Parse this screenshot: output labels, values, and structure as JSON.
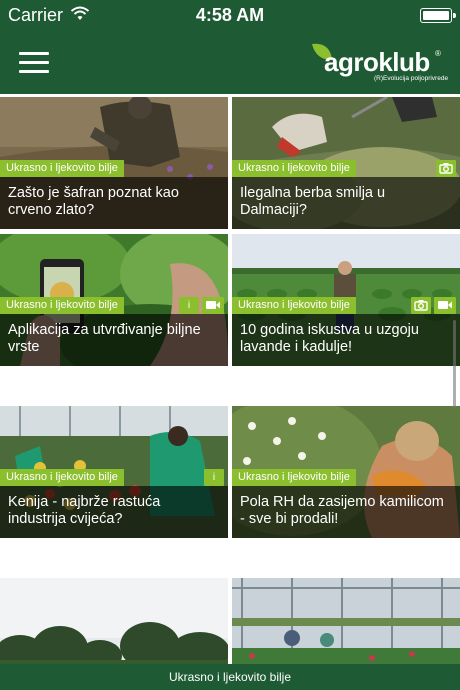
{
  "status_bar": {
    "carrier": "Carrier",
    "time": "4:58 AM"
  },
  "header": {
    "logo_prefix": "agro",
    "logo_suffix": "klub",
    "logo_registered": "®",
    "logo_tagline": "(R)Evolucija poljoprivrede"
  },
  "articles": [
    {
      "category": "Ukrasno i ljekovito bilje",
      "title": "Zašto je šafran poznat kao crveno zlato?",
      "badges": []
    },
    {
      "category": "Ukrasno i ljekovito bilje",
      "title": "Ilegalna berba smilja u Dalmaciji?",
      "badges": [
        "camera-icon"
      ]
    },
    {
      "category": "Ukrasno i ljekovito bilje",
      "title": "Aplikacija za utvrđivanje biljne vrste",
      "badges": [
        "i",
        "video-icon"
      ]
    },
    {
      "category": "Ukrasno i ljekovito bilje",
      "title": "10 godina iskustva u uzgoju lavande i kadulje!",
      "badges": [
        "camera-icon",
        "video-icon"
      ]
    },
    {
      "category": "Ukrasno i ljekovito bilje",
      "title": "Kenija - najbrže rastuća industrija cvijeća?",
      "badges": [
        "i"
      ]
    },
    {
      "category": "Ukrasno i ljekovito bilje",
      "title": "Pola RH da zasijemo kamilicom - sve bi prodali!",
      "badges": []
    },
    {
      "category": "",
      "title": "",
      "badges": []
    },
    {
      "category": "",
      "title": "",
      "badges": []
    }
  ],
  "bottom_bar": {
    "label": "Ukrasno i ljekovito bilje"
  },
  "colors": {
    "header_green": "#1e5a33",
    "tag_green": "#8cbf2e"
  }
}
